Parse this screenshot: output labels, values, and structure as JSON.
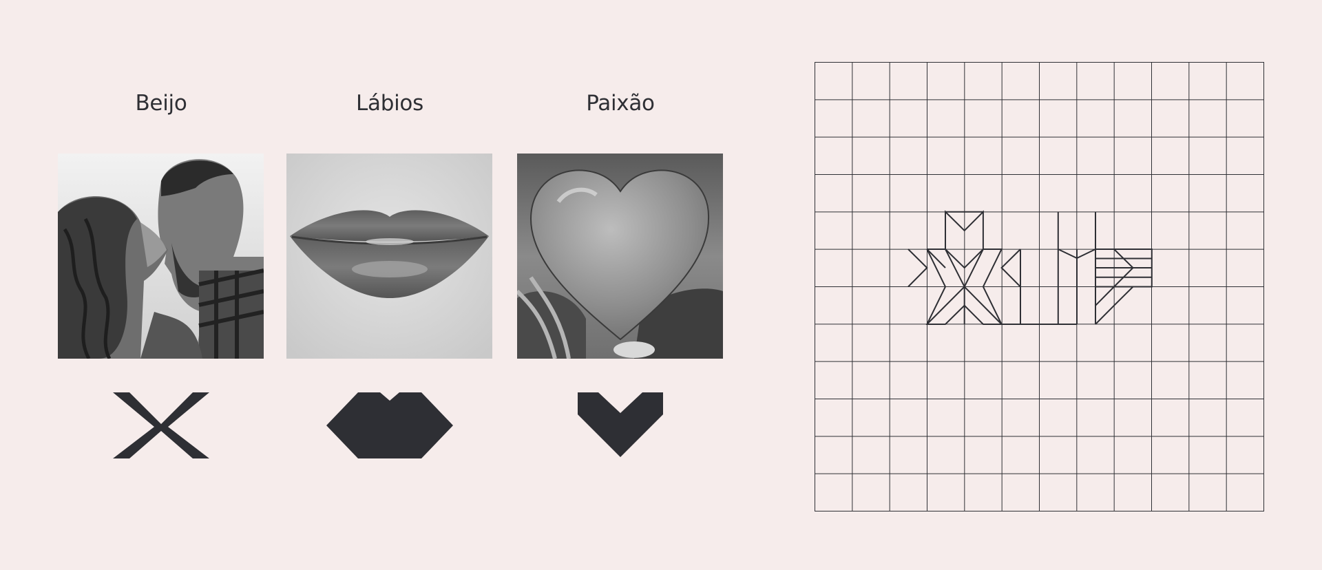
{
  "concepts": [
    {
      "title": "Beijo",
      "photo": "couple-kissing-photo",
      "icon": "kiss-x-icon"
    },
    {
      "title": "Lábios",
      "photo": "lips-photo",
      "icon": "lips-icon"
    },
    {
      "title": "Paixão",
      "photo": "heart-balloon-photo",
      "icon": "heart-icon"
    }
  ],
  "logo_grid": {
    "columns": 12,
    "rows": 12,
    "icon": "logo-construction-icon"
  },
  "colors": {
    "background": "#f6eceb",
    "ink": "#2e2f34"
  }
}
